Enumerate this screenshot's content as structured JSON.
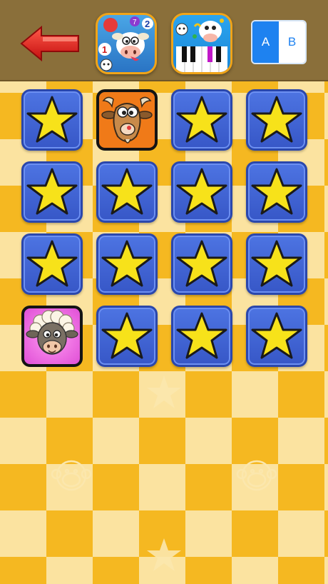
{
  "header": {
    "back": "back-arrow",
    "app_icon_1": "counting-cow-app",
    "app_icon_2": "piano-cow-app",
    "toggle": {
      "a_label": "A",
      "b_label": "B",
      "selected": "A"
    }
  },
  "board": {
    "rows": 4,
    "cols": 4,
    "cards": [
      {
        "state": "hidden",
        "icon": "star-icon"
      },
      {
        "state": "revealed",
        "icon": "goat-face"
      },
      {
        "state": "hidden",
        "icon": "star-icon"
      },
      {
        "state": "hidden",
        "icon": "star-icon"
      },
      {
        "state": "hidden",
        "icon": "star-icon"
      },
      {
        "state": "hidden",
        "icon": "star-icon"
      },
      {
        "state": "hidden",
        "icon": "star-icon"
      },
      {
        "state": "hidden",
        "icon": "star-icon"
      },
      {
        "state": "hidden",
        "icon": "star-icon"
      },
      {
        "state": "hidden",
        "icon": "star-icon"
      },
      {
        "state": "hidden",
        "icon": "star-icon"
      },
      {
        "state": "hidden",
        "icon": "star-icon"
      },
      {
        "state": "revealed",
        "icon": "sheep-face"
      },
      {
        "state": "hidden",
        "icon": "star-icon"
      },
      {
        "state": "hidden",
        "icon": "star-icon"
      },
      {
        "state": "hidden",
        "icon": "star-icon"
      }
    ]
  },
  "colors": {
    "topbar": "#8a6f3a",
    "card_blue": "#3f62d6",
    "star_yellow": "#f7e21a",
    "board_light": "#fbe3a0",
    "board_dark": "#f5b821"
  }
}
